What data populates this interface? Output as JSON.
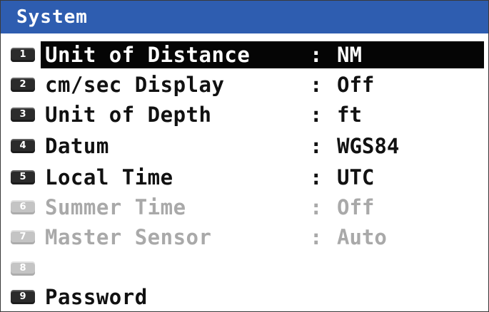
{
  "title": "System",
  "menu": {
    "items": [
      {
        "key": "1",
        "label": "Unit of Distance",
        "separator": ":",
        "value": "NM",
        "state": "selected"
      },
      {
        "key": "2",
        "label": "cm/sec Display",
        "separator": ":",
        "value": "Off",
        "state": "enabled"
      },
      {
        "key": "3",
        "label": "Unit of Depth",
        "separator": ":",
        "value": "ft",
        "state": "enabled"
      },
      {
        "key": "4",
        "label": "Datum",
        "separator": ":",
        "value": "WGS84",
        "state": "enabled"
      },
      {
        "key": "5",
        "label": "Local Time",
        "separator": ":",
        "value": "UTC",
        "state": "enabled"
      },
      {
        "key": "6",
        "label": "Summer Time",
        "separator": ":",
        "value": "Off",
        "state": "disabled"
      },
      {
        "key": "7",
        "label": "Master Sensor",
        "separator": ":",
        "value": "Auto",
        "state": "disabled"
      },
      {
        "key": "8",
        "label": "",
        "separator": "",
        "value": "",
        "state": "disabled"
      },
      {
        "key": "9",
        "label": "Password",
        "separator": "",
        "value": "",
        "state": "enabled"
      }
    ]
  },
  "colors": {
    "title_bar": "#2e5db0",
    "selection": "#050505",
    "text": "#111111",
    "disabled_text": "#a9a9a9"
  }
}
